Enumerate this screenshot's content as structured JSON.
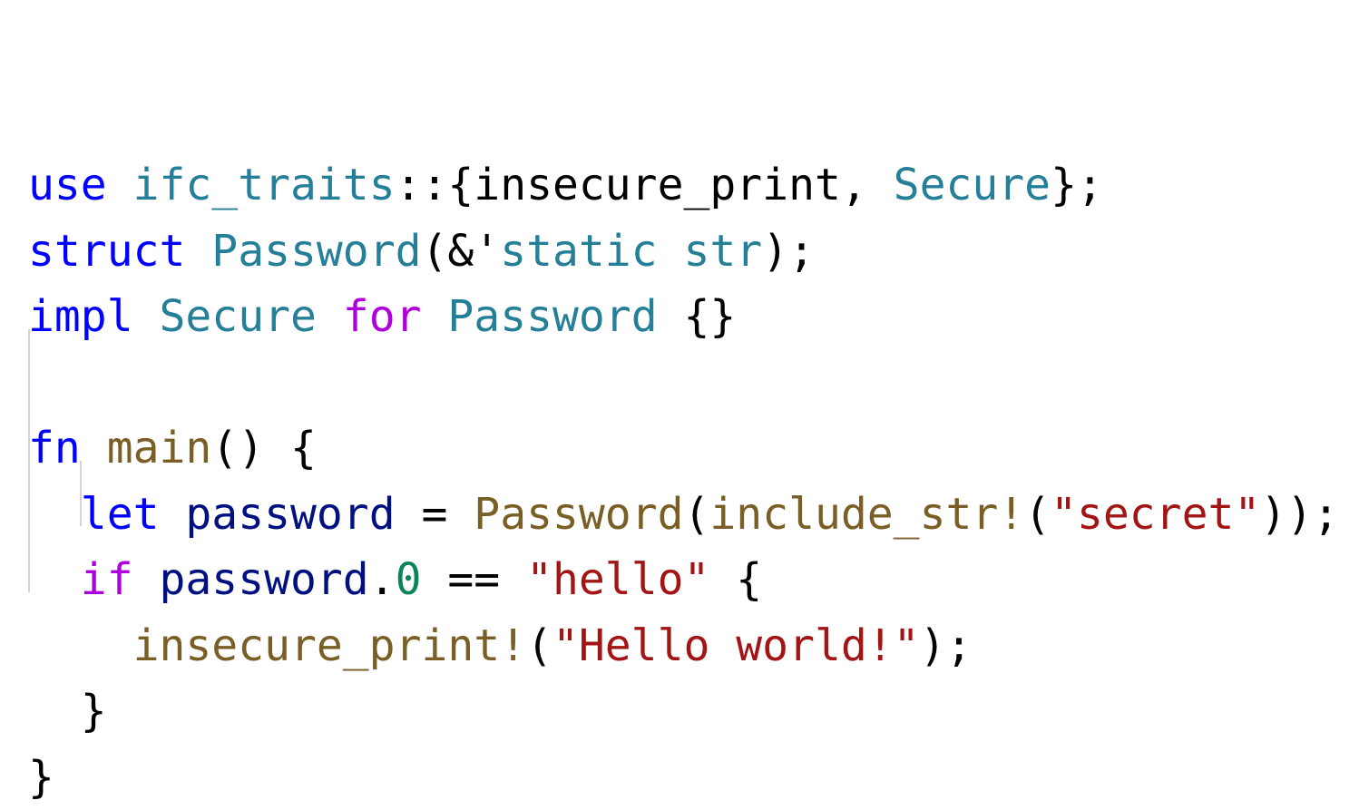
{
  "editor": {
    "language": "rust",
    "colors": {
      "keyword": "#0000ff",
      "control": "#af00db",
      "type": "#267f99",
      "function": "#795e26",
      "variable": "#001080",
      "string": "#a31515",
      "number": "#098658",
      "punctuation": "#000000",
      "indent_guide": "#d4d4d4",
      "background": "#ffffff"
    },
    "lines": [
      {
        "indent": 0,
        "tokens": [
          {
            "text": "use",
            "kind": "kw"
          },
          {
            "text": " ",
            "kind": "plain"
          },
          {
            "text": "ifc_traits",
            "kind": "ty"
          },
          {
            "text": "::{insecure_print, ",
            "kind": "plain"
          },
          {
            "text": "Secure",
            "kind": "ty"
          },
          {
            "text": "};",
            "kind": "plain"
          }
        ]
      },
      {
        "indent": 0,
        "tokens": [
          {
            "text": "struct",
            "kind": "kw"
          },
          {
            "text": " ",
            "kind": "plain"
          },
          {
            "text": "Password",
            "kind": "ty"
          },
          {
            "text": "(&'",
            "kind": "plain"
          },
          {
            "text": "static",
            "kind": "ty"
          },
          {
            "text": " ",
            "kind": "plain"
          },
          {
            "text": "str",
            "kind": "ty"
          },
          {
            "text": ");",
            "kind": "plain"
          }
        ]
      },
      {
        "indent": 0,
        "tokens": [
          {
            "text": "impl",
            "kind": "kw"
          },
          {
            "text": " ",
            "kind": "plain"
          },
          {
            "text": "Secure",
            "kind": "ty"
          },
          {
            "text": " ",
            "kind": "plain"
          },
          {
            "text": "for",
            "kind": "cf"
          },
          {
            "text": " ",
            "kind": "plain"
          },
          {
            "text": "Password",
            "kind": "ty"
          },
          {
            "text": " {}",
            "kind": "plain"
          }
        ]
      },
      {
        "indent": 0,
        "tokens": []
      },
      {
        "indent": 0,
        "tokens": [
          {
            "text": "fn",
            "kind": "kw"
          },
          {
            "text": " ",
            "kind": "plain"
          },
          {
            "text": "main",
            "kind": "fn"
          },
          {
            "text": "() {",
            "kind": "plain"
          }
        ]
      },
      {
        "indent": 1,
        "tokens": [
          {
            "text": "let",
            "kind": "kw"
          },
          {
            "text": " ",
            "kind": "plain"
          },
          {
            "text": "password",
            "kind": "var"
          },
          {
            "text": " = ",
            "kind": "plain"
          },
          {
            "text": "Password",
            "kind": "fn"
          },
          {
            "text": "(",
            "kind": "plain"
          },
          {
            "text": "include_str!",
            "kind": "fn"
          },
          {
            "text": "(",
            "kind": "plain"
          },
          {
            "text": "\"secret\"",
            "kind": "str"
          },
          {
            "text": "));",
            "kind": "plain"
          }
        ]
      },
      {
        "indent": 1,
        "tokens": [
          {
            "text": "if",
            "kind": "cf"
          },
          {
            "text": " ",
            "kind": "plain"
          },
          {
            "text": "password",
            "kind": "var"
          },
          {
            "text": ".",
            "kind": "plain"
          },
          {
            "text": "0",
            "kind": "num"
          },
          {
            "text": " == ",
            "kind": "plain"
          },
          {
            "text": "\"hello\"",
            "kind": "str"
          },
          {
            "text": " {",
            "kind": "plain"
          }
        ]
      },
      {
        "indent": 2,
        "tokens": [
          {
            "text": "insecure_print!",
            "kind": "fn"
          },
          {
            "text": "(",
            "kind": "plain"
          },
          {
            "text": "\"Hello world!\"",
            "kind": "str"
          },
          {
            "text": ");",
            "kind": "plain"
          }
        ]
      },
      {
        "indent": 1,
        "tokens": [
          {
            "text": "}",
            "kind": "plain"
          }
        ]
      },
      {
        "indent": 0,
        "tokens": [
          {
            "text": "}",
            "kind": "plain"
          }
        ]
      }
    ]
  }
}
